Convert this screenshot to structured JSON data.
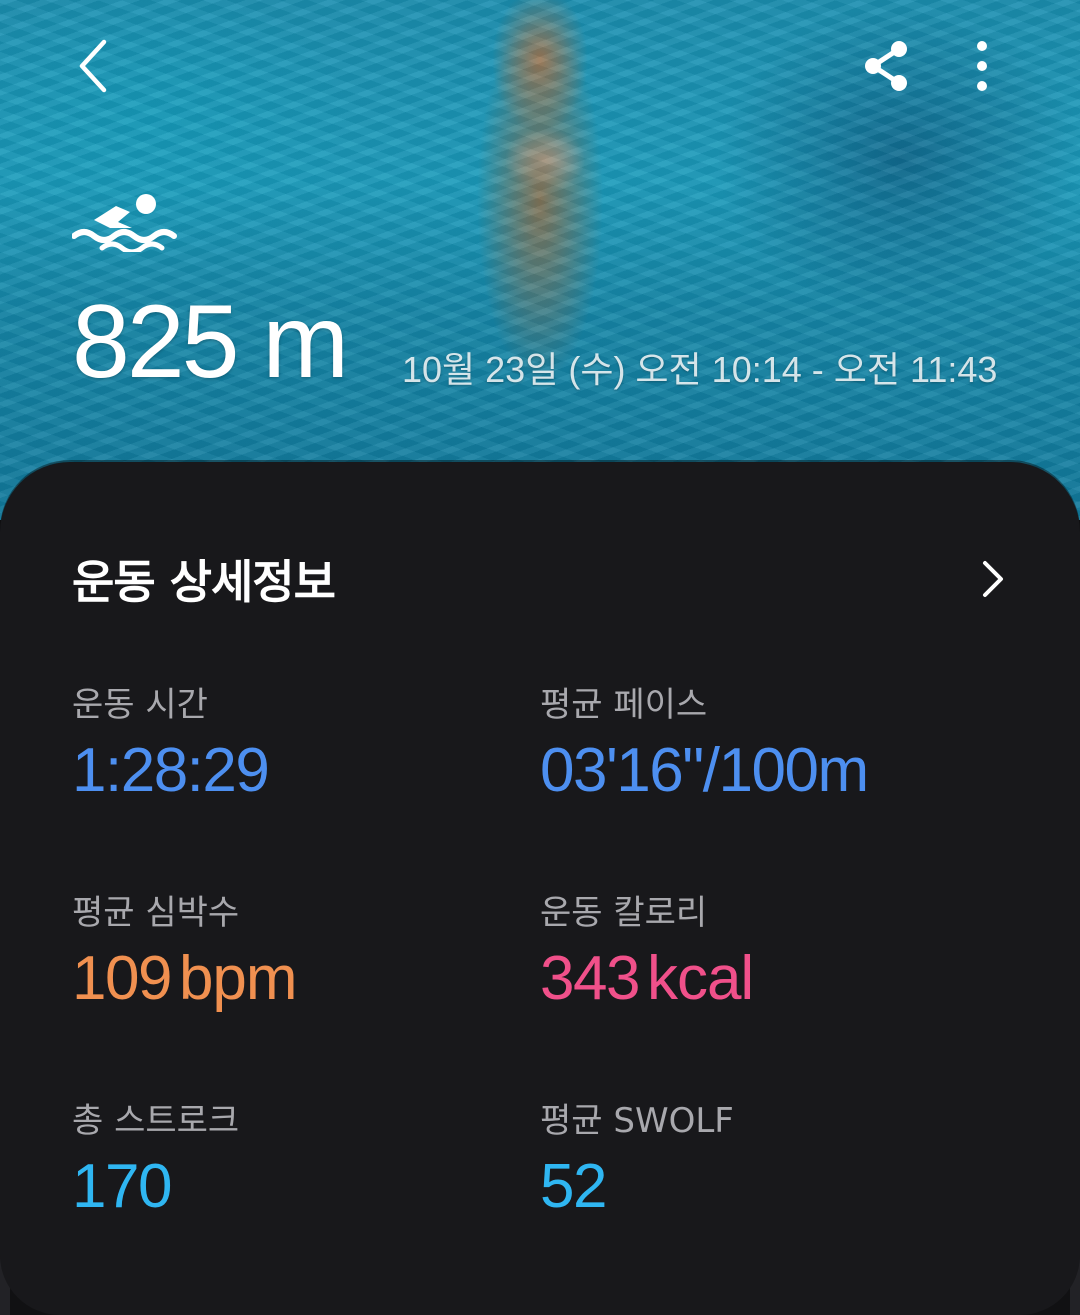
{
  "colors": {
    "time_blue": "#4d8ff0",
    "heart_orange": "#f09050",
    "calorie_pink": "#f0508a",
    "stroke_cyan": "#2fb6f2",
    "card_bg": "#18181b"
  },
  "icons": {
    "back": "chevron-left-icon",
    "share": "share-icon",
    "more": "more-vertical-icon",
    "activity": "swimming-icon",
    "details": "chevron-right-icon"
  },
  "summary": {
    "distance": "825 m",
    "datetime": "10월 23일 (수) 오전 10:14 - 오전 11:43"
  },
  "details": {
    "title": "운동 상세정보",
    "stats": [
      {
        "label": "운동 시간",
        "value": "1:28:29",
        "unit": ""
      },
      {
        "label": "평균 페이스",
        "value": "03'16\"/100m",
        "unit": ""
      },
      {
        "label": "평균 심박수",
        "value": "109",
        "unit": "bpm"
      },
      {
        "label": "운동 칼로리",
        "value": "343",
        "unit": "kcal"
      },
      {
        "label": "총 스트로크",
        "value": "170",
        "unit": ""
      },
      {
        "label": "평균 SWOLF",
        "value": "52",
        "unit": ""
      }
    ]
  }
}
